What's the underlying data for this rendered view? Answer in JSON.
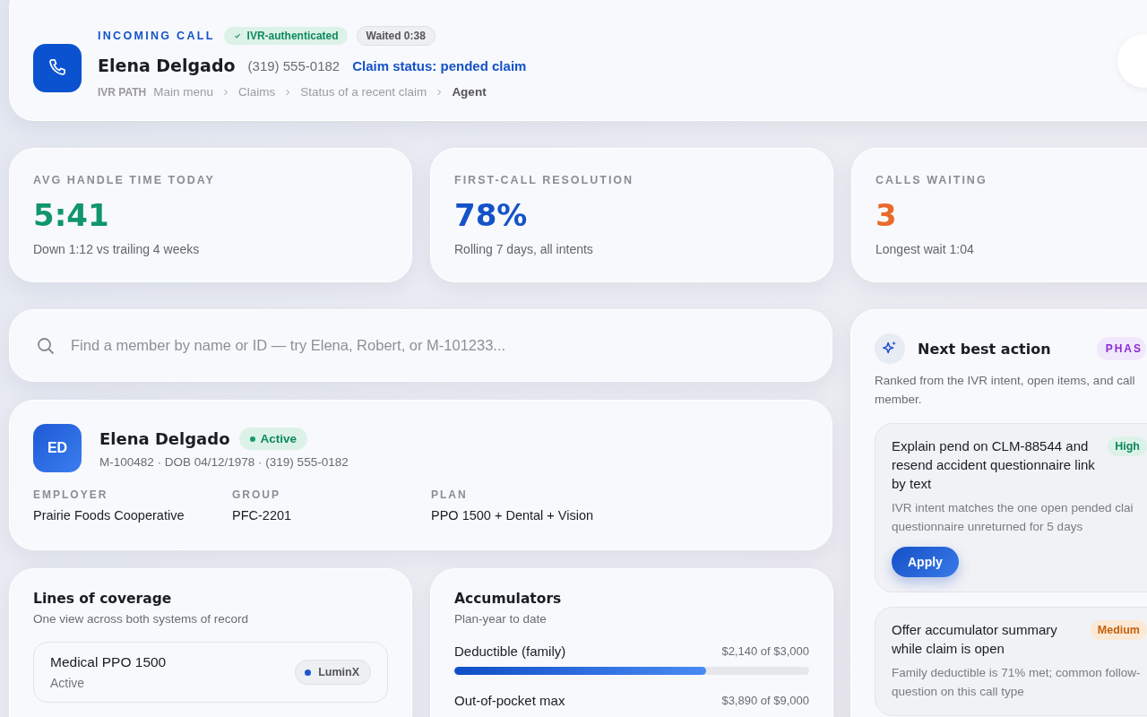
{
  "incoming_call": {
    "label": "INCOMING CALL",
    "auth_badge": "IVR-authenticated",
    "wait_badge": "Waited 0:38",
    "caller": "Elena Delgado",
    "phone": "(319) 555-0182",
    "claim_status_link": "Claim status: pended claim",
    "ivr_path": {
      "label": "IVR PATH",
      "steps": [
        {
          "text": "Main menu",
          "current": false
        },
        {
          "text": "Claims",
          "current": false
        },
        {
          "text": "Status of a recent claim",
          "current": false
        },
        {
          "text": "Agent",
          "current": true
        }
      ]
    }
  },
  "stats": [
    {
      "label": "AVG HANDLE TIME TODAY",
      "value": "5:41",
      "color": "#10966a",
      "note": "Down 1:12 vs trailing 4 weeks"
    },
    {
      "label": "FIRST-CALL RESOLUTION",
      "value": "78%",
      "color": "#1452c8",
      "note": "Rolling 7 days, all intents"
    },
    {
      "label": "CALLS WAITING",
      "value": "3",
      "color": "#ea6a2a",
      "note": "Longest wait 1:04"
    }
  ],
  "search": {
    "placeholder": "Find a member by name or ID — try Elena, Robert, or M-101233..."
  },
  "member": {
    "initials": "ED",
    "name": "Elena Delgado",
    "status": "Active",
    "meta": "M-100482 · DOB 04/12/1978 · (319) 555-0182",
    "fields": [
      {
        "label": "EMPLOYER",
        "value": "Prairie Foods Cooperative"
      },
      {
        "label": "GROUP",
        "value": "PFC-2201"
      },
      {
        "label": "PLAN",
        "value": "PPO 1500 + Dental + Vision"
      }
    ]
  },
  "coverage": {
    "title": "Lines of coverage",
    "subtitle": "One view across both systems of record",
    "lines": [
      {
        "name": "Medical PPO 1500",
        "status": "Active",
        "system": "LuminX",
        "color": "#1d56d0"
      }
    ]
  },
  "accumulators": {
    "title": "Accumulators",
    "subtitle": "Plan-year to date",
    "items": [
      {
        "name": "Deductible (family)",
        "reading": "$2,140 of $3,000",
        "level": 0.71
      },
      {
        "name": "Out-of-pocket max",
        "reading": "$3,890 of $9,000"
      }
    ]
  },
  "next_best_action": {
    "title": "Next best action",
    "badge": "PHAS",
    "description_lines": [
      "Ranked from the IVR intent, open items, and call",
      "member."
    ],
    "actions": [
      {
        "title": "Explain pend on CLM-88544 and resend accident questionnaire link by text",
        "priority": "High",
        "kind": "high",
        "reason_lines": [
          "IVR intent matches the one open pended clai",
          "questionnaire unreturned for 5 days"
        ],
        "button": "Apply"
      },
      {
        "title": "Offer accumulator summary while claim is open",
        "priority": "Medium",
        "kind": "medium",
        "reason_lines": [
          "Family deductible is 71% met; common follow-",
          "question on this call type"
        ]
      }
    ]
  }
}
